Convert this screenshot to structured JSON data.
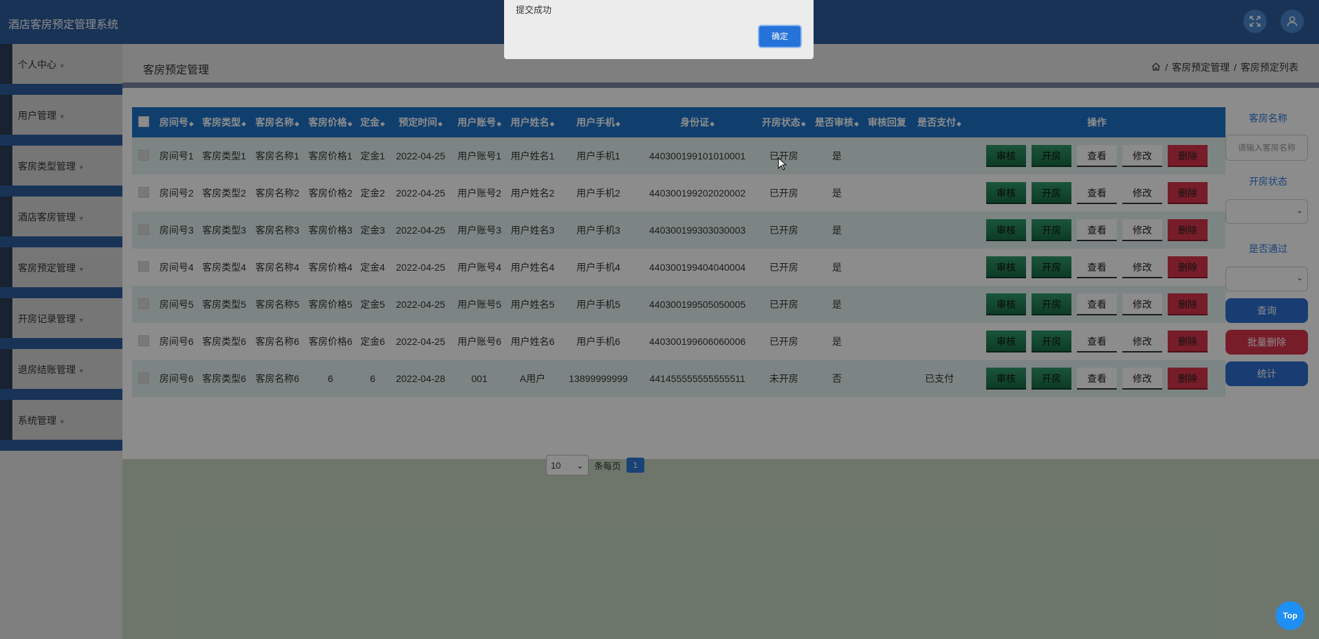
{
  "app": {
    "title": "酒店客房预定管理系统"
  },
  "topbar": {
    "icons": [
      "fullscreen-icon",
      "user-icon"
    ]
  },
  "sidebar": {
    "items": [
      {
        "label": "个人中心"
      },
      {
        "label": "用户管理"
      },
      {
        "label": "客房类型管理"
      },
      {
        "label": "酒店客房管理"
      },
      {
        "label": "客房预定管理"
      },
      {
        "label": "开房记录管理"
      },
      {
        "label": "退房结账管理"
      },
      {
        "label": "系统管理"
      }
    ]
  },
  "header": {
    "title": "客房预定管理",
    "breadcrumb": [
      "客房预定管理",
      "客房预定列表"
    ],
    "separator": "/"
  },
  "table": {
    "sort_arrow": "◆",
    "columns": [
      "房间号",
      "客房类型",
      "客房名称",
      "客房价格",
      "定金",
      "预定时间",
      "用户账号",
      "用户姓名",
      "用户手机",
      "身份证",
      "开房状态",
      "是否审核",
      "审核回复",
      "是否支付",
      "操作"
    ],
    "sortable": [
      true,
      true,
      true,
      true,
      true,
      true,
      true,
      true,
      true,
      true,
      true,
      true,
      false,
      true,
      false
    ],
    "rows": [
      [
        "房间号1",
        "客房类型1",
        "客房名称1",
        "客房价格1",
        "定金1",
        "2022-04-25",
        "用户账号1",
        "用户姓名1",
        "用户手机1",
        "440300199101010001",
        "已开房",
        "是",
        "",
        ""
      ],
      [
        "房间号2",
        "客房类型2",
        "客房名称2",
        "客房价格2",
        "定金2",
        "2022-04-25",
        "用户账号2",
        "用户姓名2",
        "用户手机2",
        "440300199202020002",
        "已开房",
        "是",
        "",
        ""
      ],
      [
        "房间号3",
        "客房类型3",
        "客房名称3",
        "客房价格3",
        "定金3",
        "2022-04-25",
        "用户账号3",
        "用户姓名3",
        "用户手机3",
        "440300199303030003",
        "已开房",
        "是",
        "",
        ""
      ],
      [
        "房间号4",
        "客房类型4",
        "客房名称4",
        "客房价格4",
        "定金4",
        "2022-04-25",
        "用户账号4",
        "用户姓名4",
        "用户手机4",
        "440300199404040004",
        "已开房",
        "是",
        "",
        ""
      ],
      [
        "房间号5",
        "客房类型5",
        "客房名称5",
        "客房价格5",
        "定金5",
        "2022-04-25",
        "用户账号5",
        "用户姓名5",
        "用户手机5",
        "440300199505050005",
        "已开房",
        "是",
        "",
        ""
      ],
      [
        "房间号6",
        "客房类型6",
        "客房名称6",
        "客房价格6",
        "定金6",
        "2022-04-25",
        "用户账号6",
        "用户姓名6",
        "用户手机6",
        "440300199606060006",
        "已开房",
        "是",
        "",
        ""
      ],
      [
        "房间号6",
        "客房类型6",
        "客房名称6",
        "6",
        "6",
        "2022-04-28",
        "001",
        "A用户",
        "13899999999",
        "441455555555555511",
        "未开房",
        "否",
        "",
        "已支付"
      ]
    ],
    "actions": [
      "审核",
      "开房",
      "查看",
      "修改",
      "删除"
    ]
  },
  "filters": {
    "room_name_label": "客房名称",
    "room_name_placeholder": "请输入客房名称",
    "open_status_label": "开房状态",
    "passed_label": "是否通过",
    "query_button": "查询",
    "batch_delete_button": "批量删除",
    "stats_button": "统计"
  },
  "pagination": {
    "page_size": "10",
    "per_page_label": "条每页",
    "current_page": "1"
  },
  "dialog": {
    "message": "提交成功",
    "confirm_button": "确定"
  },
  "back_to_top": "Top",
  "colors": {
    "primary": "#2f5e9f",
    "table_header": "#1e73c8",
    "green_button": "#1a6d46",
    "red_button": "#d9364c",
    "dialog_button": "#2573d9"
  }
}
